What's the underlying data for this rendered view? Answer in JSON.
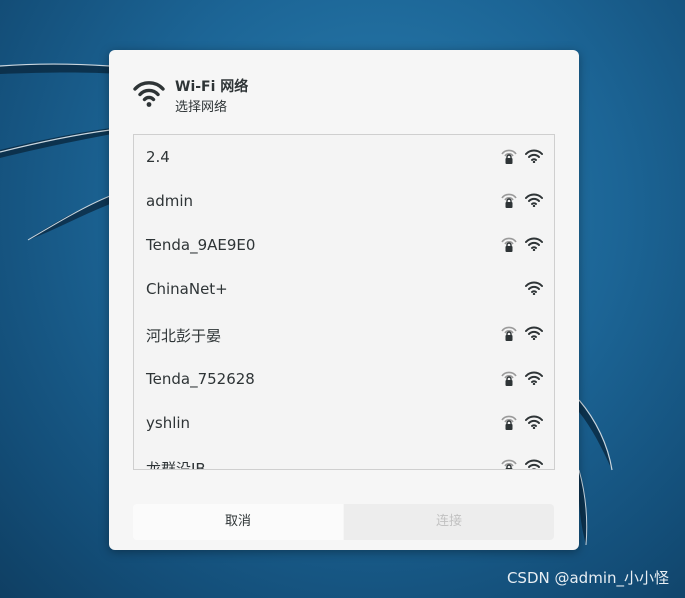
{
  "dialog": {
    "title": "Wi-Fi 网络",
    "subtitle": "选择网络",
    "header_icon": "wifi-icon"
  },
  "networks": [
    {
      "ssid": "2.4",
      "secured": true,
      "signal_icon": "wifi-signal-icon"
    },
    {
      "ssid": "admin",
      "secured": true,
      "signal_icon": "wifi-signal-icon"
    },
    {
      "ssid": "Tenda_9AE9E0",
      "secured": true,
      "signal_icon": "wifi-signal-icon"
    },
    {
      "ssid": "ChinaNet+",
      "secured": false,
      "signal_icon": "wifi-signal-icon"
    },
    {
      "ssid": "河北彭于晏",
      "secured": true,
      "signal_icon": "wifi-signal-icon"
    },
    {
      "ssid": "Tenda_752628",
      "secured": true,
      "signal_icon": "wifi-signal-icon"
    },
    {
      "ssid": "yshlin",
      "secured": true,
      "signal_icon": "wifi-signal-icon"
    },
    {
      "ssid": "龙群没JB",
      "secured": true,
      "signal_icon": "wifi-signal-icon"
    }
  ],
  "buttons": {
    "cancel": "取消",
    "connect": "连接"
  },
  "watermark": "CSDN @admin_小小怪",
  "colors": {
    "desktop": "#1c6596",
    "dialog_bg": "#f6f6f6",
    "text": "#2e3436",
    "disabled_text": "#c2c2c2"
  }
}
